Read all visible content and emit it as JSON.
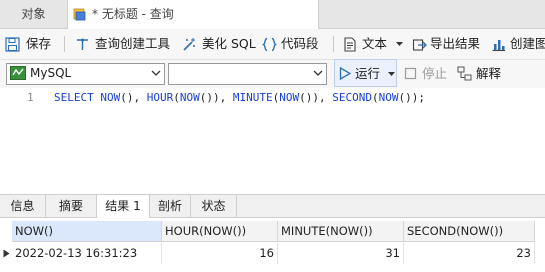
{
  "tabs": {
    "objects": "对象",
    "query": "* 无标题 - 查询"
  },
  "toolbar": {
    "save": "保存",
    "query_builder": "查询创建工具",
    "beautify_sql": "美化 SQL",
    "code_snippet": "代码段",
    "text": "文本",
    "export_results": "导出结果",
    "create_chart": "创建图"
  },
  "bar2": {
    "connection": "MySQL",
    "database": "",
    "run": "运行",
    "stop": "停止",
    "explain": "解释"
  },
  "editor": {
    "line_number": "1",
    "tokens": {
      "select": "SELECT",
      "now": "NOW",
      "hour": "HOUR",
      "minute": "MINUTE",
      "second": "SECOND",
      "p1": " ",
      "p2": "(), ",
      "p3": "(",
      "p4": "()), ",
      "p5": "(",
      "p6": "()), ",
      "p7": "(",
      "p8": "());"
    }
  },
  "result_tabs": [
    "信息",
    "摘要",
    "结果 1",
    "剖析",
    "状态"
  ],
  "grid": {
    "columns": [
      "NOW()",
      "HOUR(NOW())",
      "MINUTE(NOW())",
      "SECOND(NOW())"
    ],
    "rows": [
      [
        "2022-02-13 16:31:23",
        "16",
        "31",
        "23"
      ]
    ]
  },
  "colors": {
    "accent": "#1a3fd6",
    "selected_header": "#dbe8fb"
  }
}
